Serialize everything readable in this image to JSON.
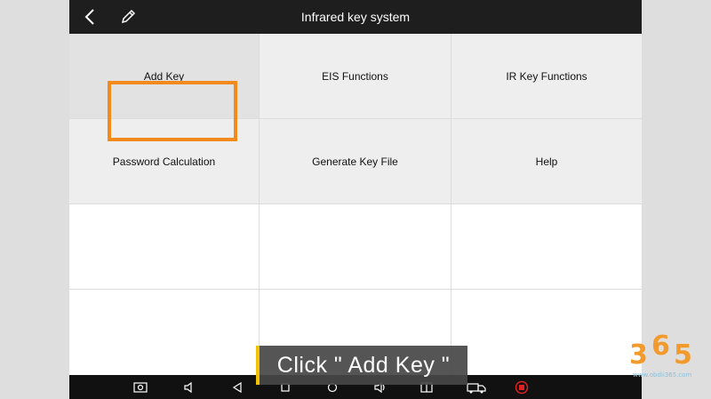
{
  "header": {
    "title": "Infrared key system",
    "back_icon": "chevron-left-icon",
    "edit_icon": "pencil-icon"
  },
  "menu": {
    "items": [
      {
        "label": "Add Key",
        "state": "selected"
      },
      {
        "label": "EIS Functions"
      },
      {
        "label": "IR Key Functions"
      },
      {
        "label": "Password Calculation"
      },
      {
        "label": "Generate Key File"
      },
      {
        "label": "Help"
      }
    ]
  },
  "navbar": {
    "icons": [
      "screenshot-icon",
      "volume-down-icon",
      "back-triangle-icon",
      "recents-square-icon",
      "home-circle-icon",
      "volume-up-icon",
      "window-icon",
      "truck-icon",
      "record-icon"
    ]
  },
  "caption": {
    "text": "Click \" Add Key \""
  },
  "watermark": {
    "digits": [
      "3",
      "6",
      "5"
    ],
    "url": "www.obdii365.com"
  },
  "colors": {
    "highlight": "#f28a1c",
    "caption_accent": "#f2c200",
    "logo": "#f39a2d",
    "record": "#e02020"
  }
}
